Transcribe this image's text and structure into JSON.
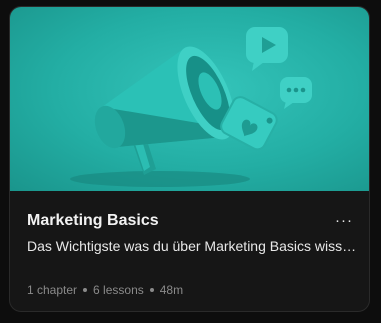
{
  "course": {
    "title": "Marketing Basics",
    "description": "Das Wichtigste was du über Marketing Basics wissen musst",
    "meta": {
      "chapters": "1 chapter",
      "lessons": "6 lessons",
      "duration": "48m"
    },
    "more_label": "···",
    "thumbnail_icon": "megaphone-icon"
  },
  "colors": {
    "thumbnail_bg": "#23aea4",
    "card_bg": "#161616",
    "title": "#f2f2f2",
    "meta": "#8a8a8a"
  }
}
